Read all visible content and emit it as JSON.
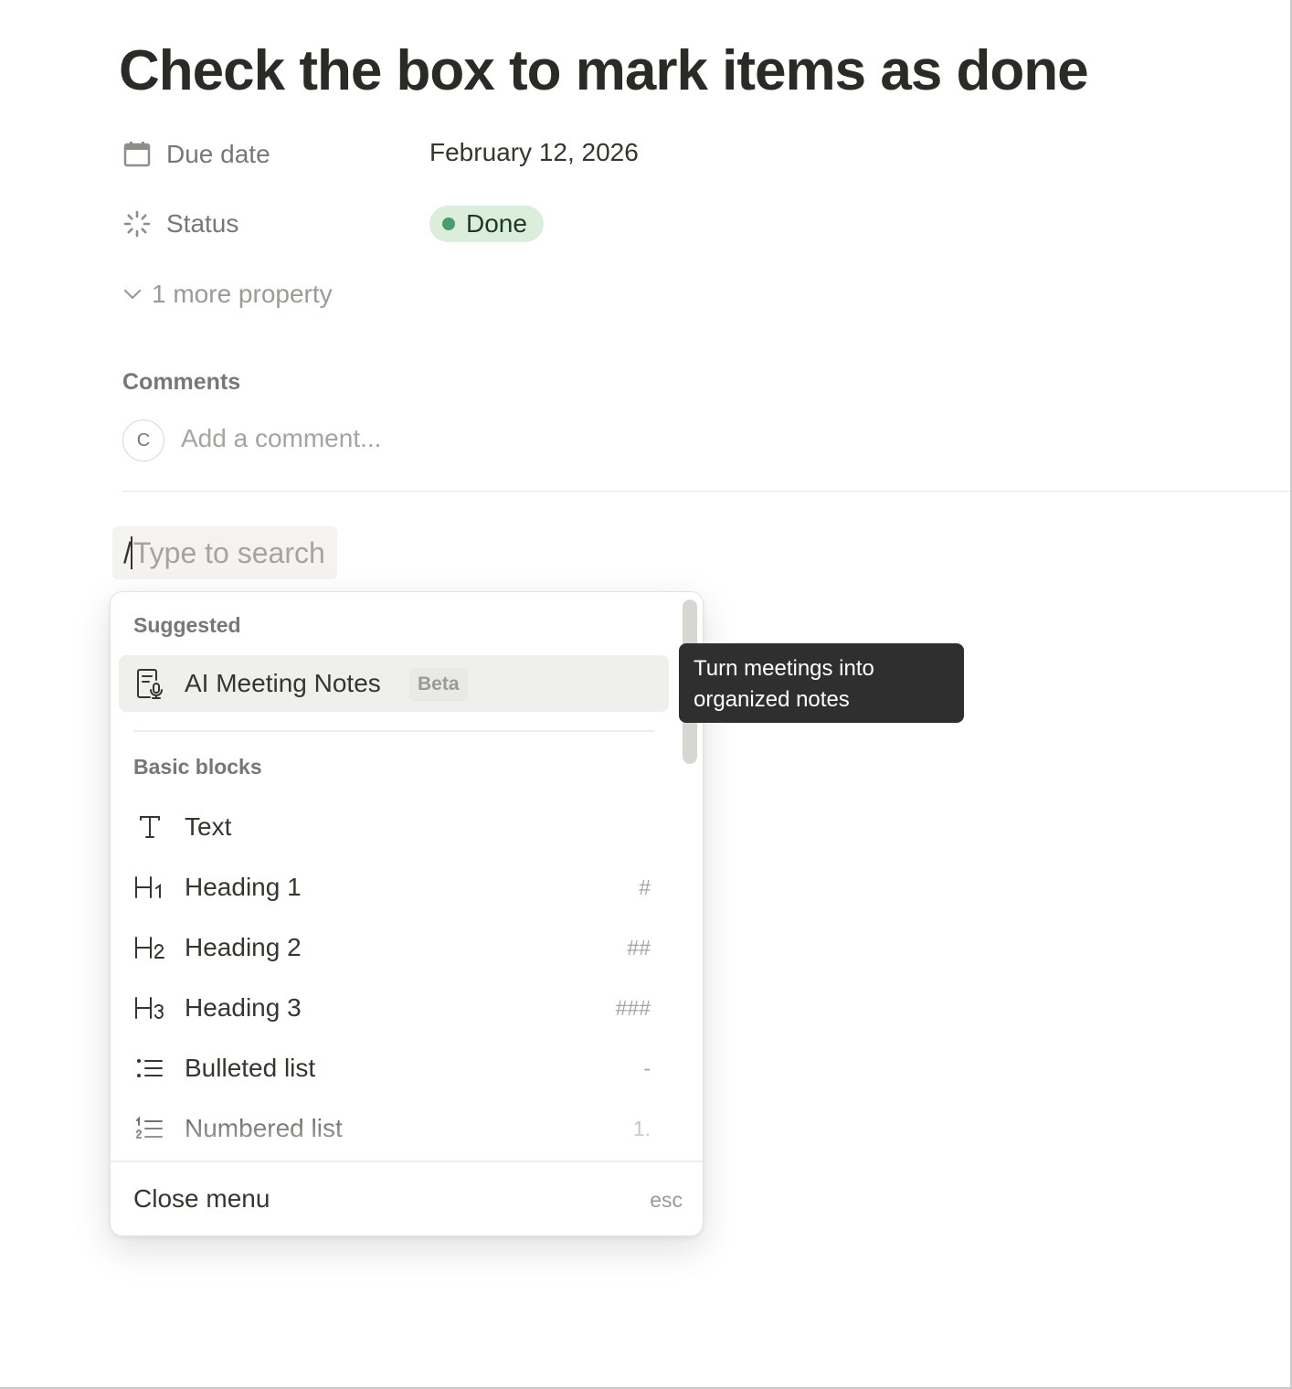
{
  "page": {
    "title": "Check the box to mark items as done"
  },
  "properties": {
    "due_date": {
      "name": "Due date",
      "value": "February 12, 2026",
      "icon": "calendar-icon"
    },
    "status": {
      "name": "Status",
      "value": "Done",
      "icon": "status-icon",
      "color": "#4a9c6d",
      "background": "#dbeddb"
    },
    "more": "1 more property"
  },
  "comments": {
    "heading": "Comments",
    "avatar_initial": "C",
    "placeholder": "Add a comment..."
  },
  "slash_command": {
    "prefix": "/",
    "placeholder": "Type to search"
  },
  "menu": {
    "suggested_label": "Suggested",
    "suggested_item": {
      "label": "AI Meeting Notes",
      "badge": "Beta",
      "icon": "meeting-notes-icon"
    },
    "basic_label": "Basic blocks",
    "items": [
      {
        "label": "Text",
        "shortcut": "",
        "icon": "text-icon"
      },
      {
        "label": "Heading 1",
        "shortcut": "#",
        "icon": "heading-1-icon"
      },
      {
        "label": "Heading 2",
        "shortcut": "##",
        "icon": "heading-2-icon"
      },
      {
        "label": "Heading 3",
        "shortcut": "###",
        "icon": "heading-3-icon"
      },
      {
        "label": "Bulleted list",
        "shortcut": "-",
        "icon": "bulleted-list-icon"
      },
      {
        "label": "Numbered list",
        "shortcut": "1.",
        "icon": "numbered-list-icon"
      }
    ],
    "close_label": "Close menu",
    "close_key": "esc"
  },
  "tooltip": {
    "text": "Turn meetings into organized notes"
  }
}
